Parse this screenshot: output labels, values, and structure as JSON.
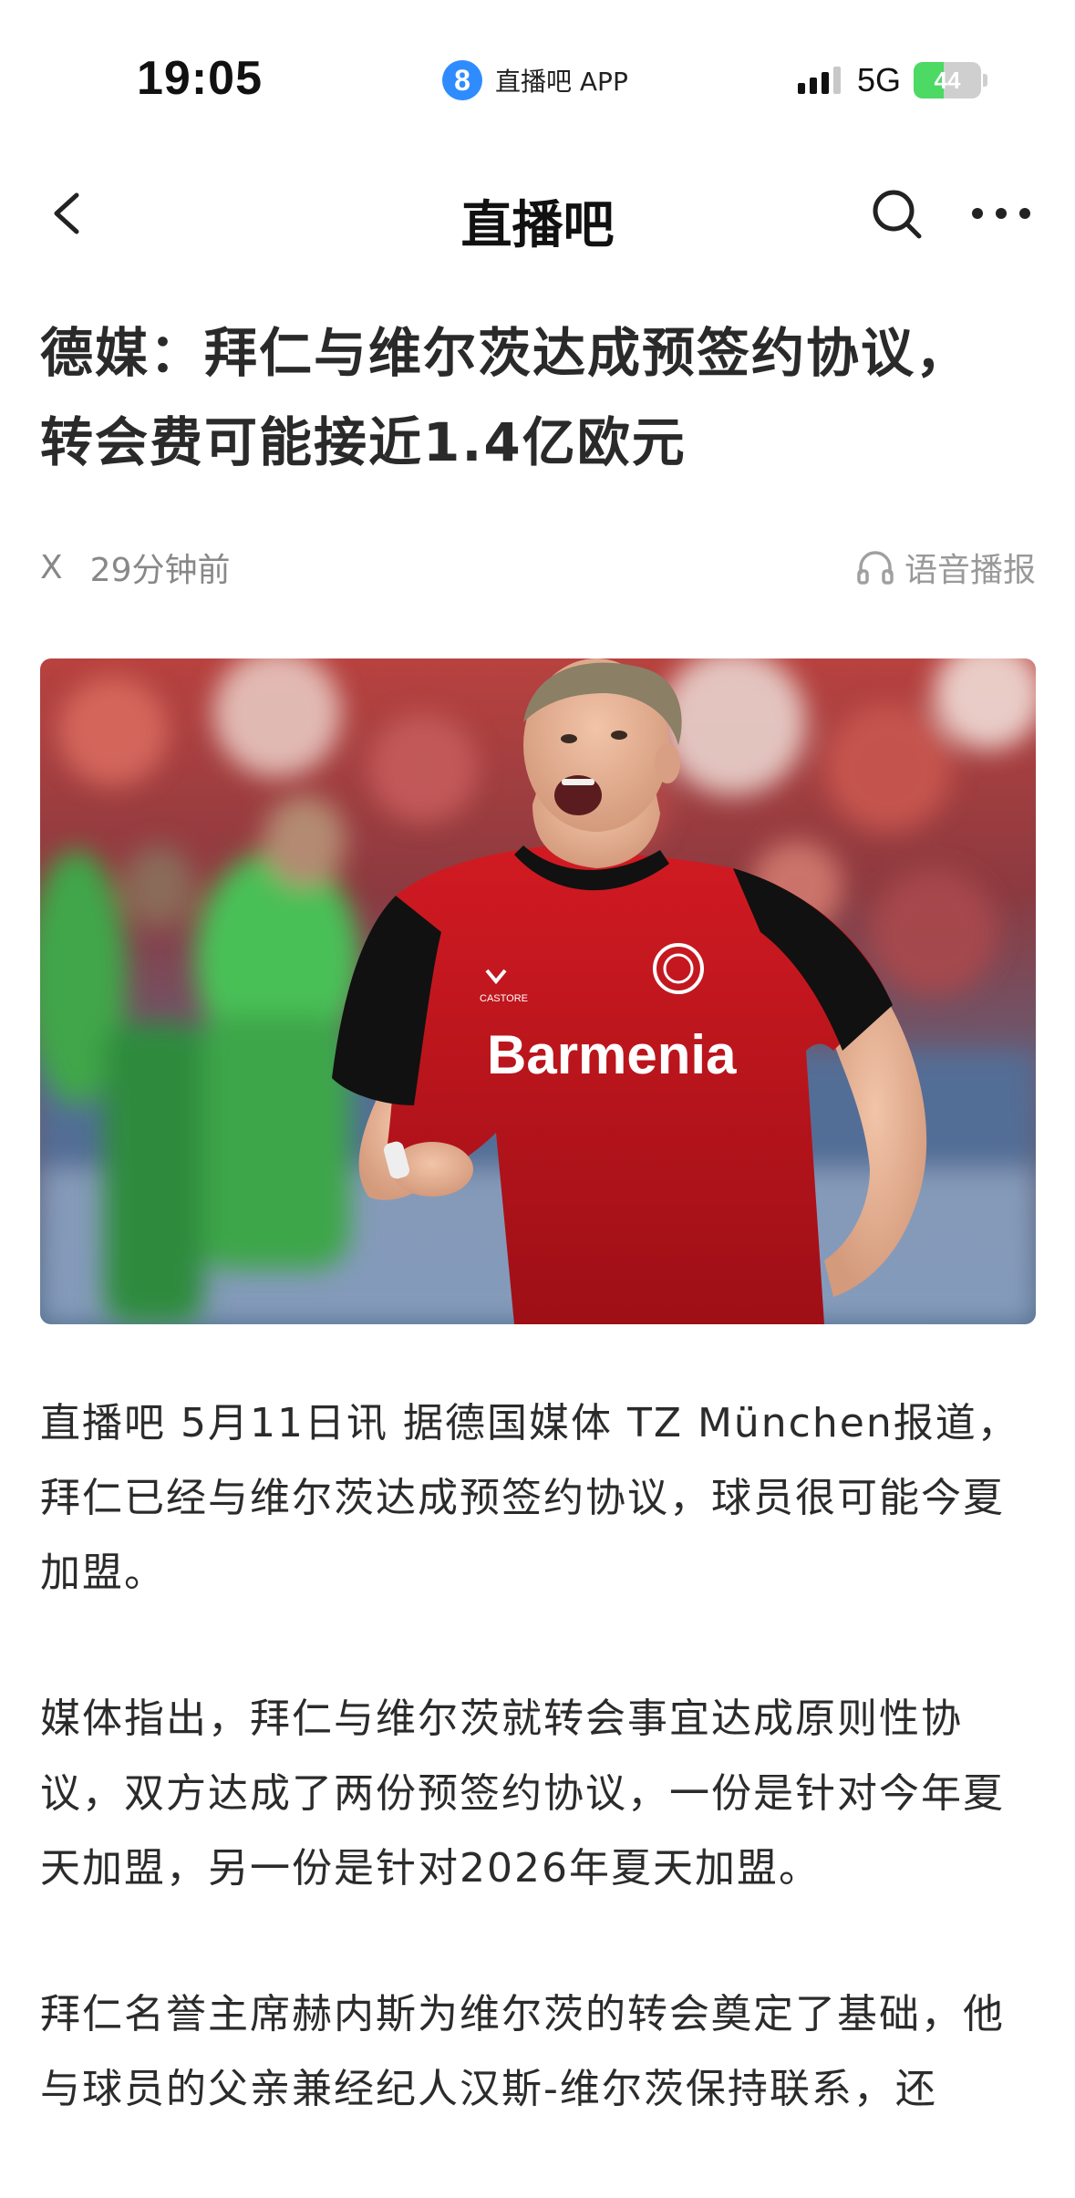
{
  "status_bar": {
    "time": "19:05",
    "app_badge": "8",
    "app_name": "直播吧 APP",
    "network": "5G",
    "battery_level": "44",
    "battery_fraction": 0.44,
    "signal_bars_active": 3,
    "signal_bars_total": 4
  },
  "nav": {
    "title": "直播吧",
    "back_icon": "chevron-left-icon",
    "search_icon": "search-icon",
    "more_icon": "more-horizontal-icon"
  },
  "article": {
    "title_line1": "德媒：拜仁与维尔茨达成预签约协议，",
    "title_line2": "转会费可能接近1.4亿欧元",
    "source": "X",
    "time_ago": "29分钟前",
    "tts_label": "语音播报",
    "tts_icon": "headphones-icon",
    "paragraphs": [
      "直播吧 5月11日讯  据德国媒体 TZ  München报道，拜仁已经与维尔茨达成预签约协议，球员很可能今夏加盟。",
      "媒体指出，拜仁与维尔茨就转会事宜达成原则性协议，双方达成了两份预签约协议，一份是针对今年夏天加盟，另一份是针对2026年夏天加盟。",
      "拜仁名誉主席赫内斯为维尔茨的转会奠定了基础，他与球员的父亲兼经纪人汉斯-维尔茨保持联系，还"
    ]
  },
  "hero_image": {
    "jersey_sponsor": "Barmenia",
    "kit_brand": "CASTORE"
  },
  "colors": {
    "accent_blue": "#2f8cff",
    "battery_green": "#4cd964",
    "meta_gray": "#888888",
    "jersey_red": "#c8161d"
  }
}
